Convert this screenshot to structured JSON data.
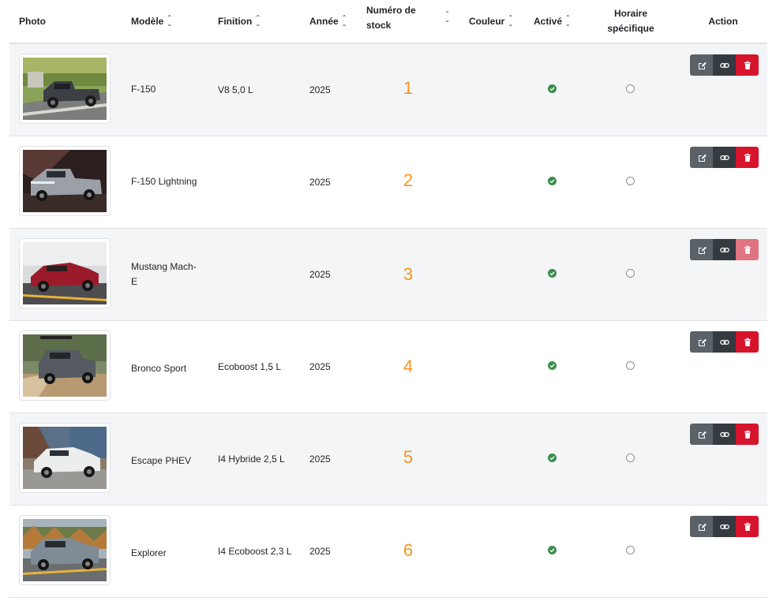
{
  "headers": {
    "photo": "Photo",
    "model": "Modèle",
    "trim": "Finition",
    "year": "Année",
    "stock": "Numéro de stock",
    "color": "Couleur",
    "active": "Activé",
    "schedule": "Horaire spécifique",
    "action": "Action"
  },
  "rows": [
    {
      "model": "F-150",
      "trim": "V8 5,0 L",
      "year": "2025",
      "stock": "1",
      "active": true,
      "specific_schedule": false,
      "image": "ford-f150-truck-photo"
    },
    {
      "model": "F-150 Lightning",
      "trim": "",
      "year": "2025",
      "stock": "2",
      "active": true,
      "specific_schedule": false,
      "image": "ford-f150-lightning-photo"
    },
    {
      "model": "Mustang Mach-E",
      "trim": "",
      "year": "2025",
      "stock": "3",
      "active": true,
      "specific_schedule": false,
      "image": "ford-mustang-mach-e-photo"
    },
    {
      "model": "Bronco Sport",
      "trim": "Ecoboost 1,5 L",
      "year": "2025",
      "stock": "4",
      "active": true,
      "specific_schedule": false,
      "image": "ford-bronco-sport-photo"
    },
    {
      "model": "Escape PHEV",
      "trim": "I4 Hybride 2,5 L",
      "year": "2025",
      "stock": "5",
      "active": true,
      "specific_schedule": false,
      "image": "ford-escape-phev-photo"
    },
    {
      "model": "Explorer",
      "trim": "I4 Ecoboost 2,3 L",
      "year": "2025",
      "stock": "6",
      "active": true,
      "specific_schedule": false,
      "image": "ford-explorer-photo"
    }
  ],
  "icons": {
    "sort": "sort-icon",
    "active": "check-circle-icon",
    "schedule": "empty-circle-icon",
    "edit": "edit-icon",
    "link": "link-icon",
    "delete": "trash-icon"
  },
  "colors": {
    "stock_number": "#f7941d",
    "active_check": "#3c8d4c",
    "edit_button": "#5a6268",
    "link_button": "#343a40",
    "delete_button": "#d6142b",
    "delete_button_hover": "#e07480",
    "row_stripe": "#f4f5f7"
  }
}
